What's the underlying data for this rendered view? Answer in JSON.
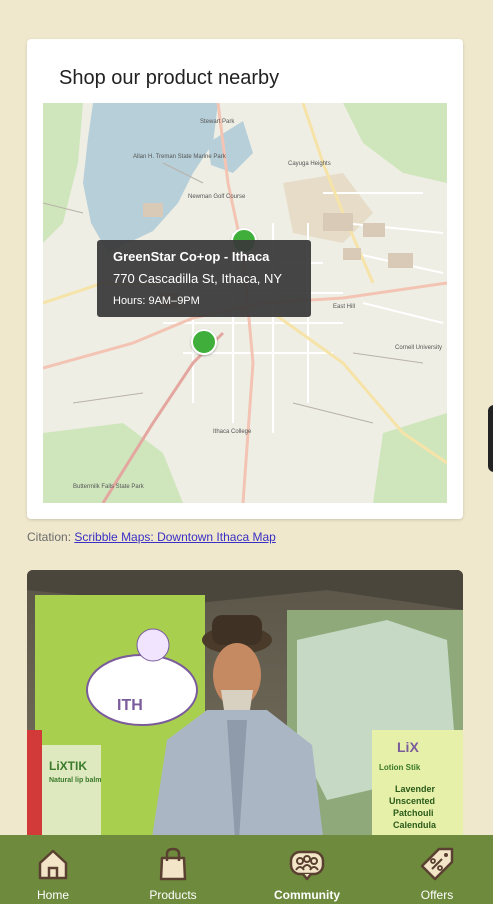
{
  "map_section": {
    "title": "Shop our product nearby",
    "tooltip": {
      "name": "GreenStar Co+op - Ithaca",
      "address": "770 Cascadilla St, Ithaca, NY",
      "hours": "Hours: 9AM–9PM"
    },
    "map_labels": [
      "Allan H. Treman State Marine Park",
      "Stewart Park",
      "Newman Golf Course",
      "Cayuga Heights",
      "Cornell University",
      "East Hill",
      "Ithaca College",
      "Buttermilk Falls State Park"
    ]
  },
  "citation": {
    "prefix": "Citation:",
    "link_text": "Scribble Maps: Downtown Ithaca Map"
  },
  "photo": {
    "sign_text": [
      "LiXTIK",
      "Natural lip balm",
      "LiX",
      "Lotion Stik",
      "Lavender",
      "Unscented",
      "Patchouli",
      "Calendula",
      "ITH"
    ]
  },
  "nav": {
    "active": "Community",
    "items": [
      {
        "label": "Home",
        "icon": "home-icon"
      },
      {
        "label": "Products",
        "icon": "shopping-bag-icon"
      },
      {
        "label": "Community",
        "icon": "community-icon"
      },
      {
        "label": "Offers",
        "icon": "discount-tag-icon"
      }
    ]
  },
  "colors": {
    "background": "#efe8cd",
    "nav_background": "#6e8b3d",
    "marker": "#3fae3a",
    "link": "#3a2fc4",
    "icon_fill": "#f3e6c8",
    "icon_stroke": "#5a4030"
  }
}
